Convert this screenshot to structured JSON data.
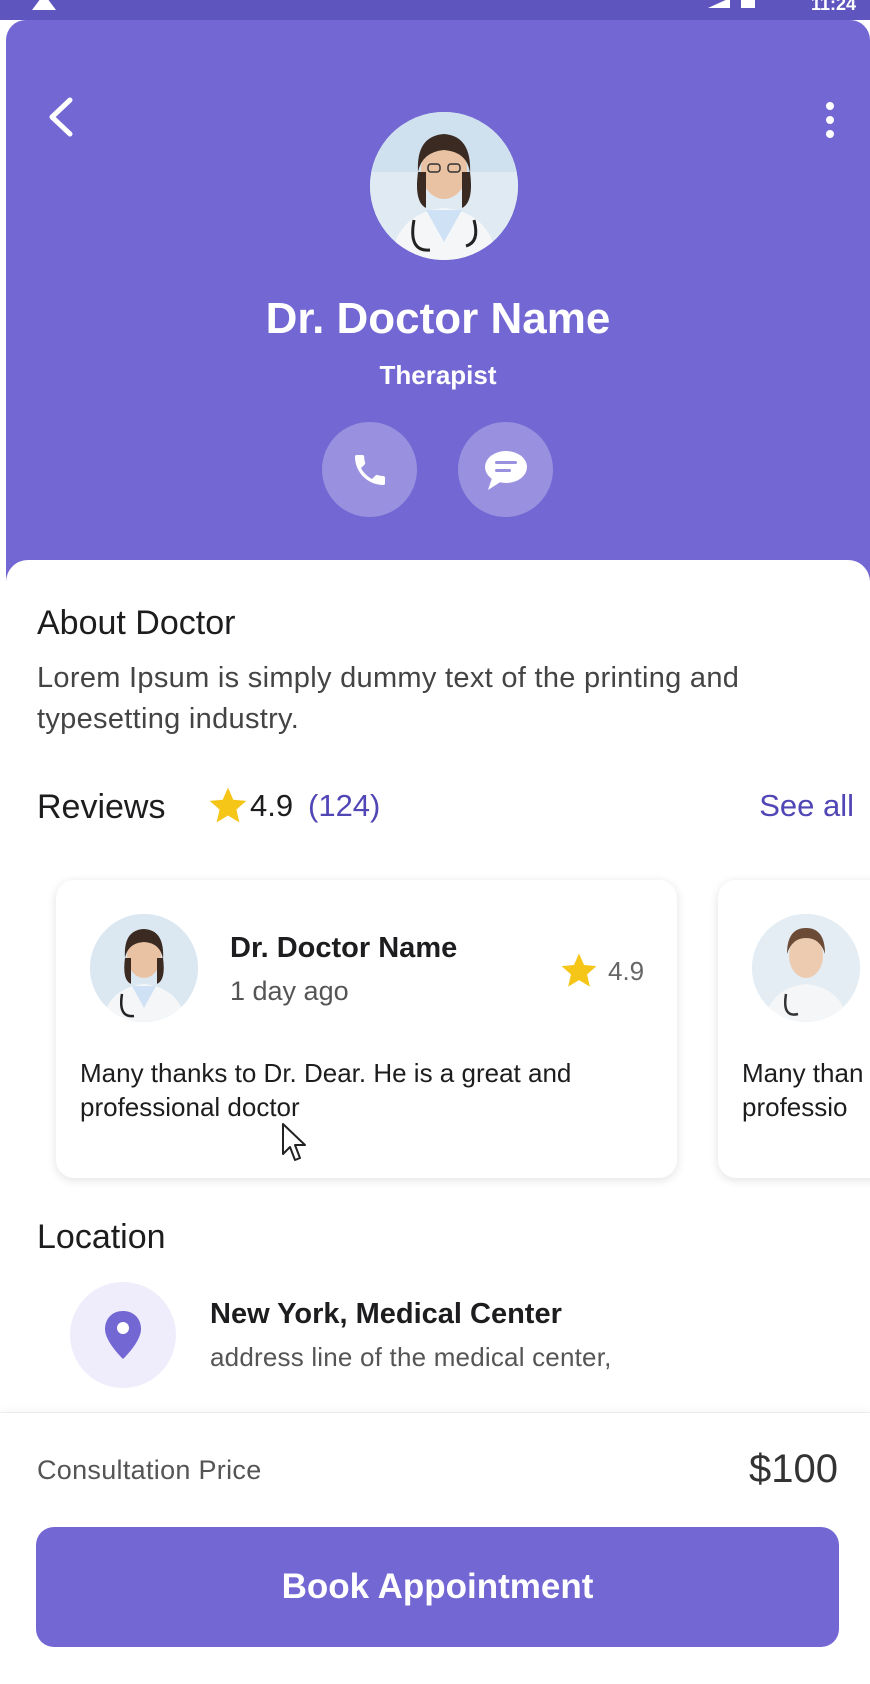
{
  "status_bar": {
    "time": "11:24"
  },
  "header": {
    "doctor_name": "Dr. Doctor Name",
    "doctor_role": "Therapist"
  },
  "about": {
    "title": "About Doctor",
    "text": "Lorem Ipsum is simply dummy text of the printing and typesetting industry."
  },
  "reviews": {
    "title": "Reviews",
    "rating": "4.9",
    "count": "(124)",
    "see_all_label": "See all",
    "items": [
      {
        "name": "Dr. Doctor Name",
        "time": "1 day ago",
        "rating": "4.9",
        "text": "Many thanks to Dr. Dear. He is a great and professional doctor"
      },
      {
        "text_line1": "Many than",
        "text_line2": "professio"
      }
    ]
  },
  "location": {
    "title": "Location",
    "name": "New York, Medical Center",
    "address": "address line of the medical center,"
  },
  "booking": {
    "price_label": "Consultation Price",
    "price_value": "$100",
    "button_label": "Book Appointment"
  },
  "colors": {
    "primary": "#7267d3",
    "accent_text": "#5146b5",
    "star": "#f5c518",
    "pin": "#7267d3"
  }
}
